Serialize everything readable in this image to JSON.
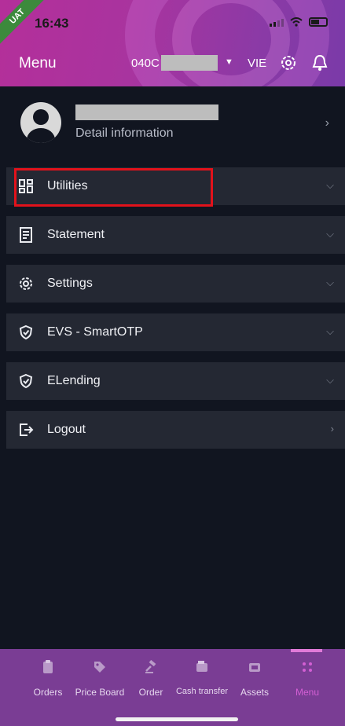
{
  "status_bar": {
    "time": "16:43",
    "badge": "UAT"
  },
  "header": {
    "title": "Menu",
    "account_prefix": "040C",
    "language": "VIE"
  },
  "profile": {
    "detail_label": "Detail information"
  },
  "menu_items": [
    {
      "label": "Utilities",
      "icon": "grid-icon"
    },
    {
      "label": "Statement",
      "icon": "document-icon"
    },
    {
      "label": "Settings",
      "icon": "gear-icon"
    },
    {
      "label": "EVS - SmartOTP",
      "icon": "shield-check-icon"
    },
    {
      "label": "ELending",
      "icon": "shield-check-icon"
    },
    {
      "label": "Logout",
      "icon": "logout-icon"
    }
  ],
  "bottom_nav": [
    {
      "label": "Orders",
      "icon": "clipboard-icon"
    },
    {
      "label": "Price Board",
      "icon": "tag-icon"
    },
    {
      "label": "Order",
      "icon": "gavel-icon"
    },
    {
      "label": "Cash transfer",
      "icon": "wallet-icon"
    },
    {
      "label": "Assets",
      "icon": "wallet-stack-icon"
    },
    {
      "label": "Menu",
      "icon": "dots-grid-icon",
      "active": true
    }
  ],
  "colors": {
    "header_gradient_start": "#b42f9a",
    "header_gradient_end": "#7a3aa8",
    "background": "#111520",
    "row_background": "#242833",
    "highlight": "#e2121b",
    "nav_background": "#7a3d94",
    "nav_active": "#d35fd4"
  }
}
